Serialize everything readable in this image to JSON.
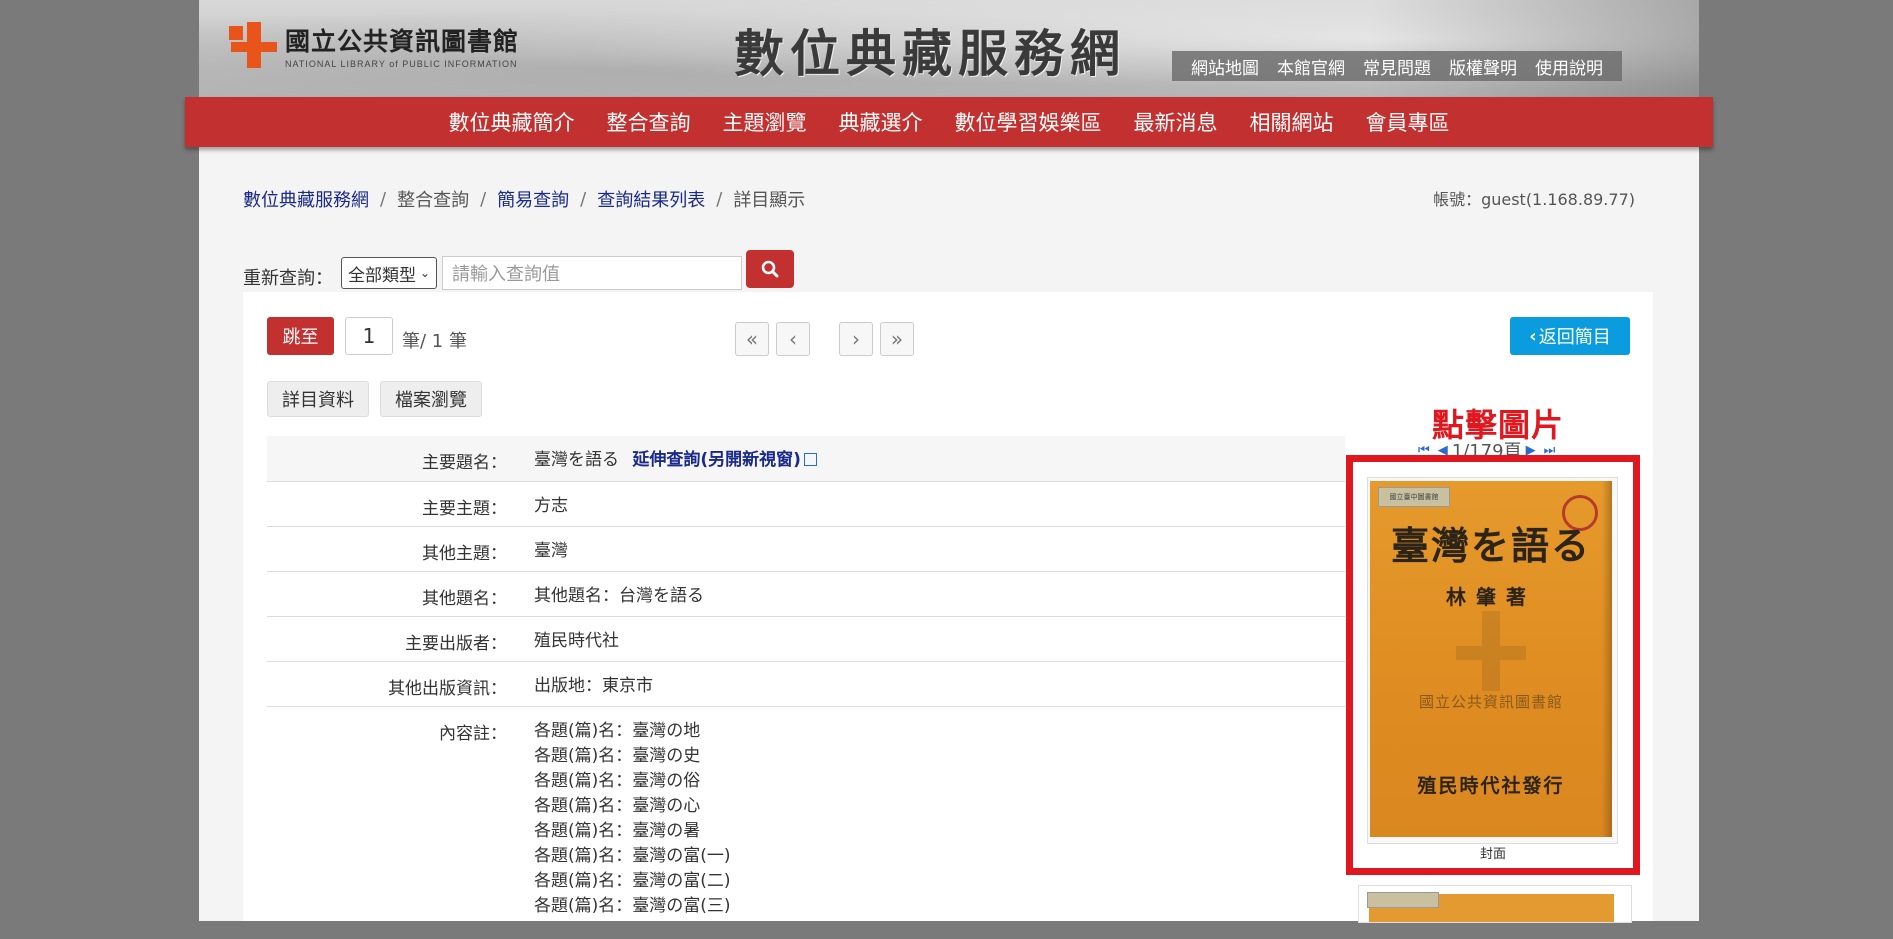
{
  "header": {
    "logo_zh": "國立公共資訊圖書館",
    "logo_en": "NATIONAL LIBRARY of PUBLIC INFORMATION",
    "site_title": "數位典藏服務網",
    "top_links": [
      "網站地圖",
      "本館官網",
      "常見問題",
      "版權聲明",
      "使用說明"
    ]
  },
  "nav": [
    "數位典藏簡介",
    "整合查詢",
    "主題瀏覽",
    "典藏選介",
    "數位學習娛樂區",
    "最新消息",
    "相關網站",
    "會員專區"
  ],
  "breadcrumb": {
    "items": [
      {
        "label": "數位典藏服務網",
        "link": true
      },
      {
        "label": "整合查詢",
        "link": false
      },
      {
        "label": "簡易查詢",
        "link": true
      },
      {
        "label": "查詢結果列表",
        "link": true
      },
      {
        "label": "詳目顯示",
        "link": false
      }
    ],
    "separator": "/"
  },
  "account": "帳號：guest(1.168.89.77)",
  "requery": {
    "label": "重新查詢：",
    "type_selected": "全部類型",
    "placeholder": "請輸入查詢值"
  },
  "pager": {
    "jump_label": "跳至",
    "page_value": "1",
    "count_text": "筆/ 1 筆",
    "first": "«",
    "prev": "‹",
    "next": "›",
    "last": "»",
    "back_label": "返回簡目"
  },
  "tabs": [
    "詳目資料",
    "檔案瀏覽"
  ],
  "details": [
    {
      "key": "主要題名：",
      "value": "臺灣を語る",
      "link": "延伸查詢(另開新視窗)"
    },
    {
      "key": "主要主題：",
      "value": "方志"
    },
    {
      "key": "其他主題：",
      "value": "臺灣"
    },
    {
      "key": "其他題名：",
      "value": "其他題名：台灣を語る"
    },
    {
      "key": "主要出版者：",
      "value": "殖民時代社"
    },
    {
      "key": "其他出版資訊：",
      "value": "出版地：東京市"
    },
    {
      "key": "內容註：",
      "lines": [
        "各題(篇)名：臺灣の地",
        "各題(篇)名：臺灣の史",
        "各題(篇)名：臺灣の俗",
        "各題(篇)名：臺灣の心",
        "各題(篇)名：臺灣の暑",
        "各題(篇)名：臺灣の富(一)",
        "各題(篇)名：臺灣の富(二)",
        "各題(篇)名：臺灣の富(三)"
      ]
    }
  ],
  "viewer": {
    "click_hint": "點擊圖片",
    "page_indicator": "1/179頁",
    "cover_caption": "封面",
    "cover_title": "臺灣を語る",
    "cover_author": "林肇著",
    "cover_library": "國立公共資訊圖書館",
    "cover_publisher": "殖民時代社發行",
    "cover_stamp": "國立臺中圖書館"
  },
  "colors": {
    "nav_red": "#c2302f",
    "link_blue": "#1a2a8a",
    "back_blue": "#0b9ce0",
    "highlight_red": "#e0171e",
    "cover_orange": "#e08e22"
  }
}
